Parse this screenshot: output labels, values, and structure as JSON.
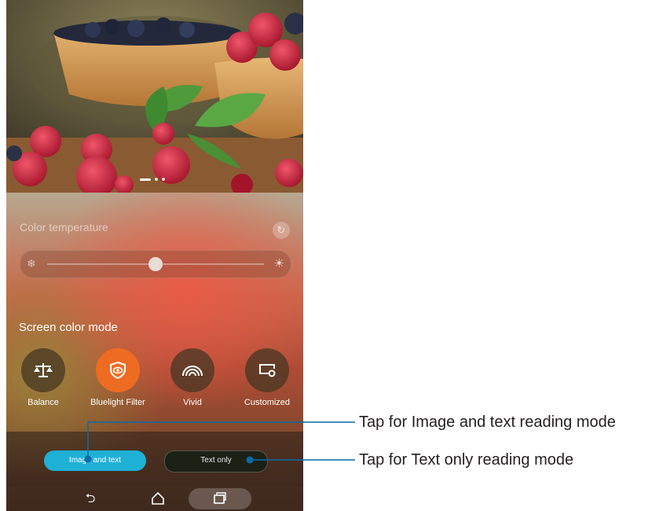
{
  "photo": {
    "dots_count": 3,
    "active_dot": 0
  },
  "color_temperature": {
    "label": "Color temperature",
    "icon_left": "snowflake-icon",
    "icon_right": "sun-icon",
    "reset_icon": "refresh-icon",
    "slider_value": 0.5
  },
  "screen_color_mode": {
    "label": "Screen color mode",
    "modes": [
      {
        "label": "Balance",
        "icon": "balance-scale-icon",
        "active": false
      },
      {
        "label": "Bluelight Filter",
        "icon": "eye-shield-icon",
        "active": true
      },
      {
        "label": "Vivid",
        "icon": "rainbow-icon",
        "active": false
      },
      {
        "label": "Customized",
        "icon": "customize-screen-icon",
        "active": false
      }
    ]
  },
  "reading_mode": {
    "image_and_text": "Image and text",
    "text_only": "Text only",
    "selected": "Image and text"
  },
  "navigation": {
    "back_icon": "back-icon",
    "home_icon": "home-icon",
    "recent_icon": "recent-apps-icon"
  },
  "callouts": {
    "image_and_text": "Tap for Image and text reading mode",
    "text_only": "Tap for Text only reading mode"
  },
  "colors": {
    "accent_orange": "#ee6c22",
    "accent_cyan": "#1fb0d6",
    "callout_line": "#0a6aa8"
  }
}
